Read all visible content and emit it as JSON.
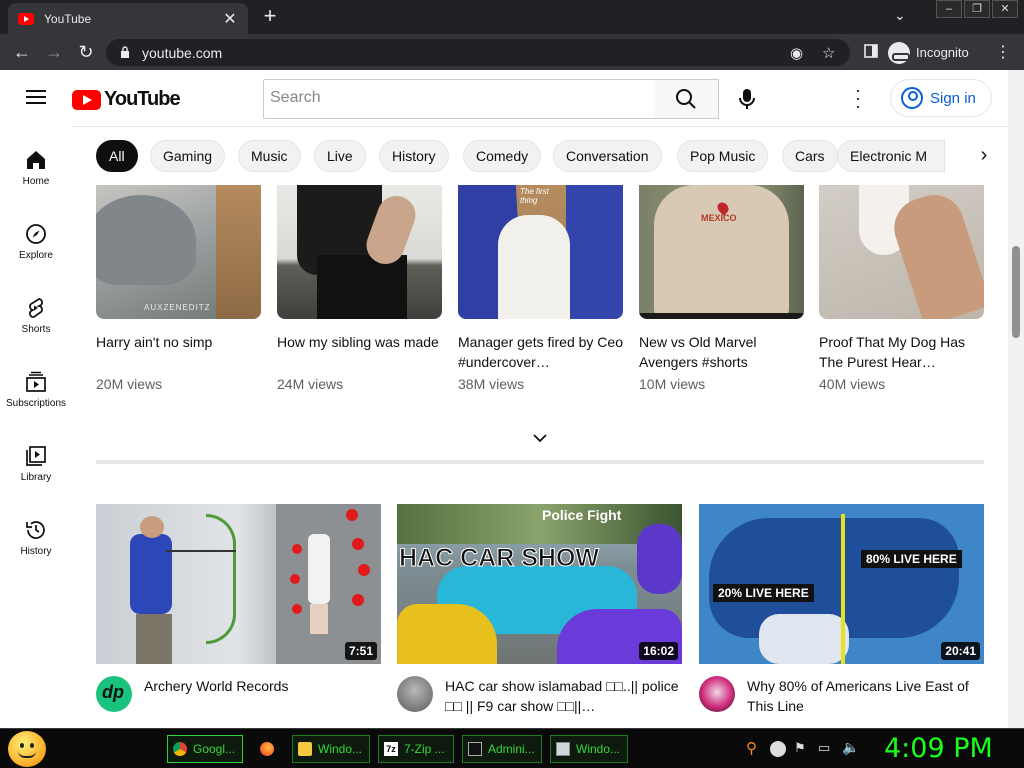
{
  "browser": {
    "tab_title": "YouTube",
    "url": "youtube.com",
    "profile_label": "Incognito"
  },
  "youtube": {
    "logo_text": "YouTube",
    "search_placeholder": "Search",
    "sign_in": "Sign in",
    "guide": [
      "Home",
      "Explore",
      "Shorts",
      "Subscriptions",
      "Library",
      "History"
    ],
    "chips": [
      "All",
      "Gaming",
      "Music",
      "Live",
      "History",
      "Comedy",
      "Conversation",
      "Pop Music",
      "Cars",
      "Electronic M"
    ],
    "shorts": [
      {
        "title": "Harry ain't no simp",
        "views": "20M views",
        "overlay": "AUXZENEDITZ"
      },
      {
        "title": "How my sibling was made",
        "views": "24M views",
        "overlay": ""
      },
      {
        "title": "Manager gets fired by Ceo #undercover…",
        "views": "38M views",
        "overlay": "The first thing"
      },
      {
        "title": "New vs Old Marvel Avengers #shorts",
        "views": "10M views",
        "overlay": "MEXICO"
      },
      {
        "title": "Proof That My Dog Has The Purest Hear…",
        "views": "40M views",
        "overlay": ""
      }
    ],
    "videos": [
      {
        "title": "Archery World Records",
        "duration": "7:51",
        "overlay": "",
        "overlay2": ""
      },
      {
        "title": "HAC car show islamabad □□..|| police □□ || F9 car show □□||…",
        "duration": "16:02",
        "overlay": "Police Fight",
        "overlay2": "HAC CAR SHOW"
      },
      {
        "title": "Why 80% of Americans Live East of This Line",
        "duration": "20:41",
        "overlay": "80% LIVE HERE",
        "overlay2": "20% LIVE HERE"
      }
    ]
  },
  "taskbar": {
    "tasks": [
      "Googl...",
      "",
      "Windo...",
      "7-Zip ...",
      "Admini...",
      "Windo..."
    ],
    "clock": "4:09 PM"
  },
  "colors": {
    "yt_red": "#ff0000",
    "link_blue": "#065fd4",
    "clock_green": "#1aff1a"
  }
}
